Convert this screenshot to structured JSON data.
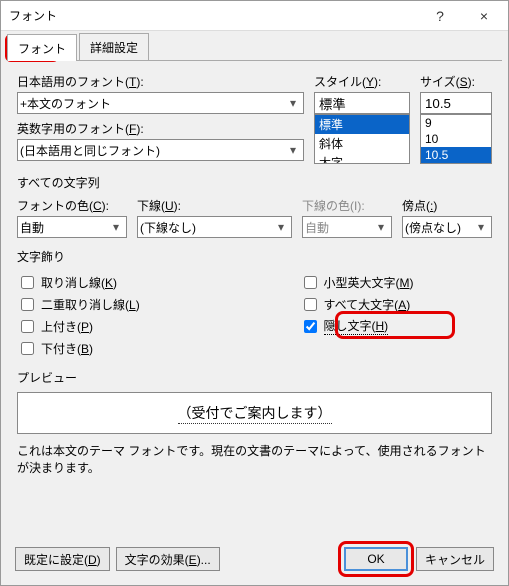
{
  "window": {
    "title": "フォント",
    "help": "?",
    "close": "×"
  },
  "tabs": {
    "font": "フォント",
    "advanced": "詳細設定"
  },
  "labels": {
    "jp_font": "日本語用のフォント(",
    "jp_font_k": "T",
    "jp_font_end": "):",
    "en_font": "英数字用のフォント(",
    "en_font_k": "F",
    "en_font_end": "):",
    "style": "スタイル(",
    "style_k": "Y",
    "style_end": "):",
    "size": "サイズ(",
    "size_k": "S",
    "size_end": "):",
    "all_text": "すべての文字列",
    "font_color": "フォントの色(",
    "font_color_k": "C",
    "font_color_end": "):",
    "underline": "下線(",
    "underline_k": "U",
    "underline_end": "):",
    "ul_color": "下線の色(I):",
    "emphasis": "傍点(",
    "emphasis_k": ":",
    "emphasis_end": ")",
    "effects": "文字飾り",
    "preview": "プレビュー"
  },
  "values": {
    "jp_font": "+本文のフォント",
    "en_font": "(日本語用と同じフォント)",
    "style_input": "標準",
    "size_input": "10.5",
    "font_color": "自動",
    "underline": "(下線なし)",
    "ul_color": "自動",
    "emphasis": "(傍点なし)"
  },
  "style_list": {
    "o0": "標準",
    "o1": "斜体",
    "o2": "太字"
  },
  "size_list": {
    "o0": "9",
    "o1": "10",
    "o2": "10.5"
  },
  "effects_checks": {
    "strike": "取り消し線(",
    "strike_k": "K",
    "strike_end": ")",
    "dstrike": "二重取り消し線(",
    "dstrike_k": "L",
    "dstrike_end": ")",
    "sup": "上付き(",
    "sup_k": "P",
    "sup_end": ")",
    "sub": "下付き(",
    "sub_k": "B",
    "sub_end": ")",
    "smallcaps": "小型英大文字(",
    "smallcaps_k": "M",
    "smallcaps_end": ")",
    "allcaps": "すべて大文字(",
    "allcaps_k": "A",
    "allcaps_end": ")",
    "hidden": "隠し文字(",
    "hidden_k": "H",
    "hidden_end": ")"
  },
  "preview_text": "（受付でご案内します）",
  "note_text": "これは本文のテーマ フォントです。現在の文書のテーマによって、使用されるフォントが決まります。",
  "buttons": {
    "set_default": "既定に設定(",
    "set_default_k": "D",
    "set_default_end": ")",
    "text_effects": "文字の効果(",
    "text_effects_k": "E",
    "text_effects_end": ")...",
    "ok": "OK",
    "cancel": "キャンセル"
  }
}
